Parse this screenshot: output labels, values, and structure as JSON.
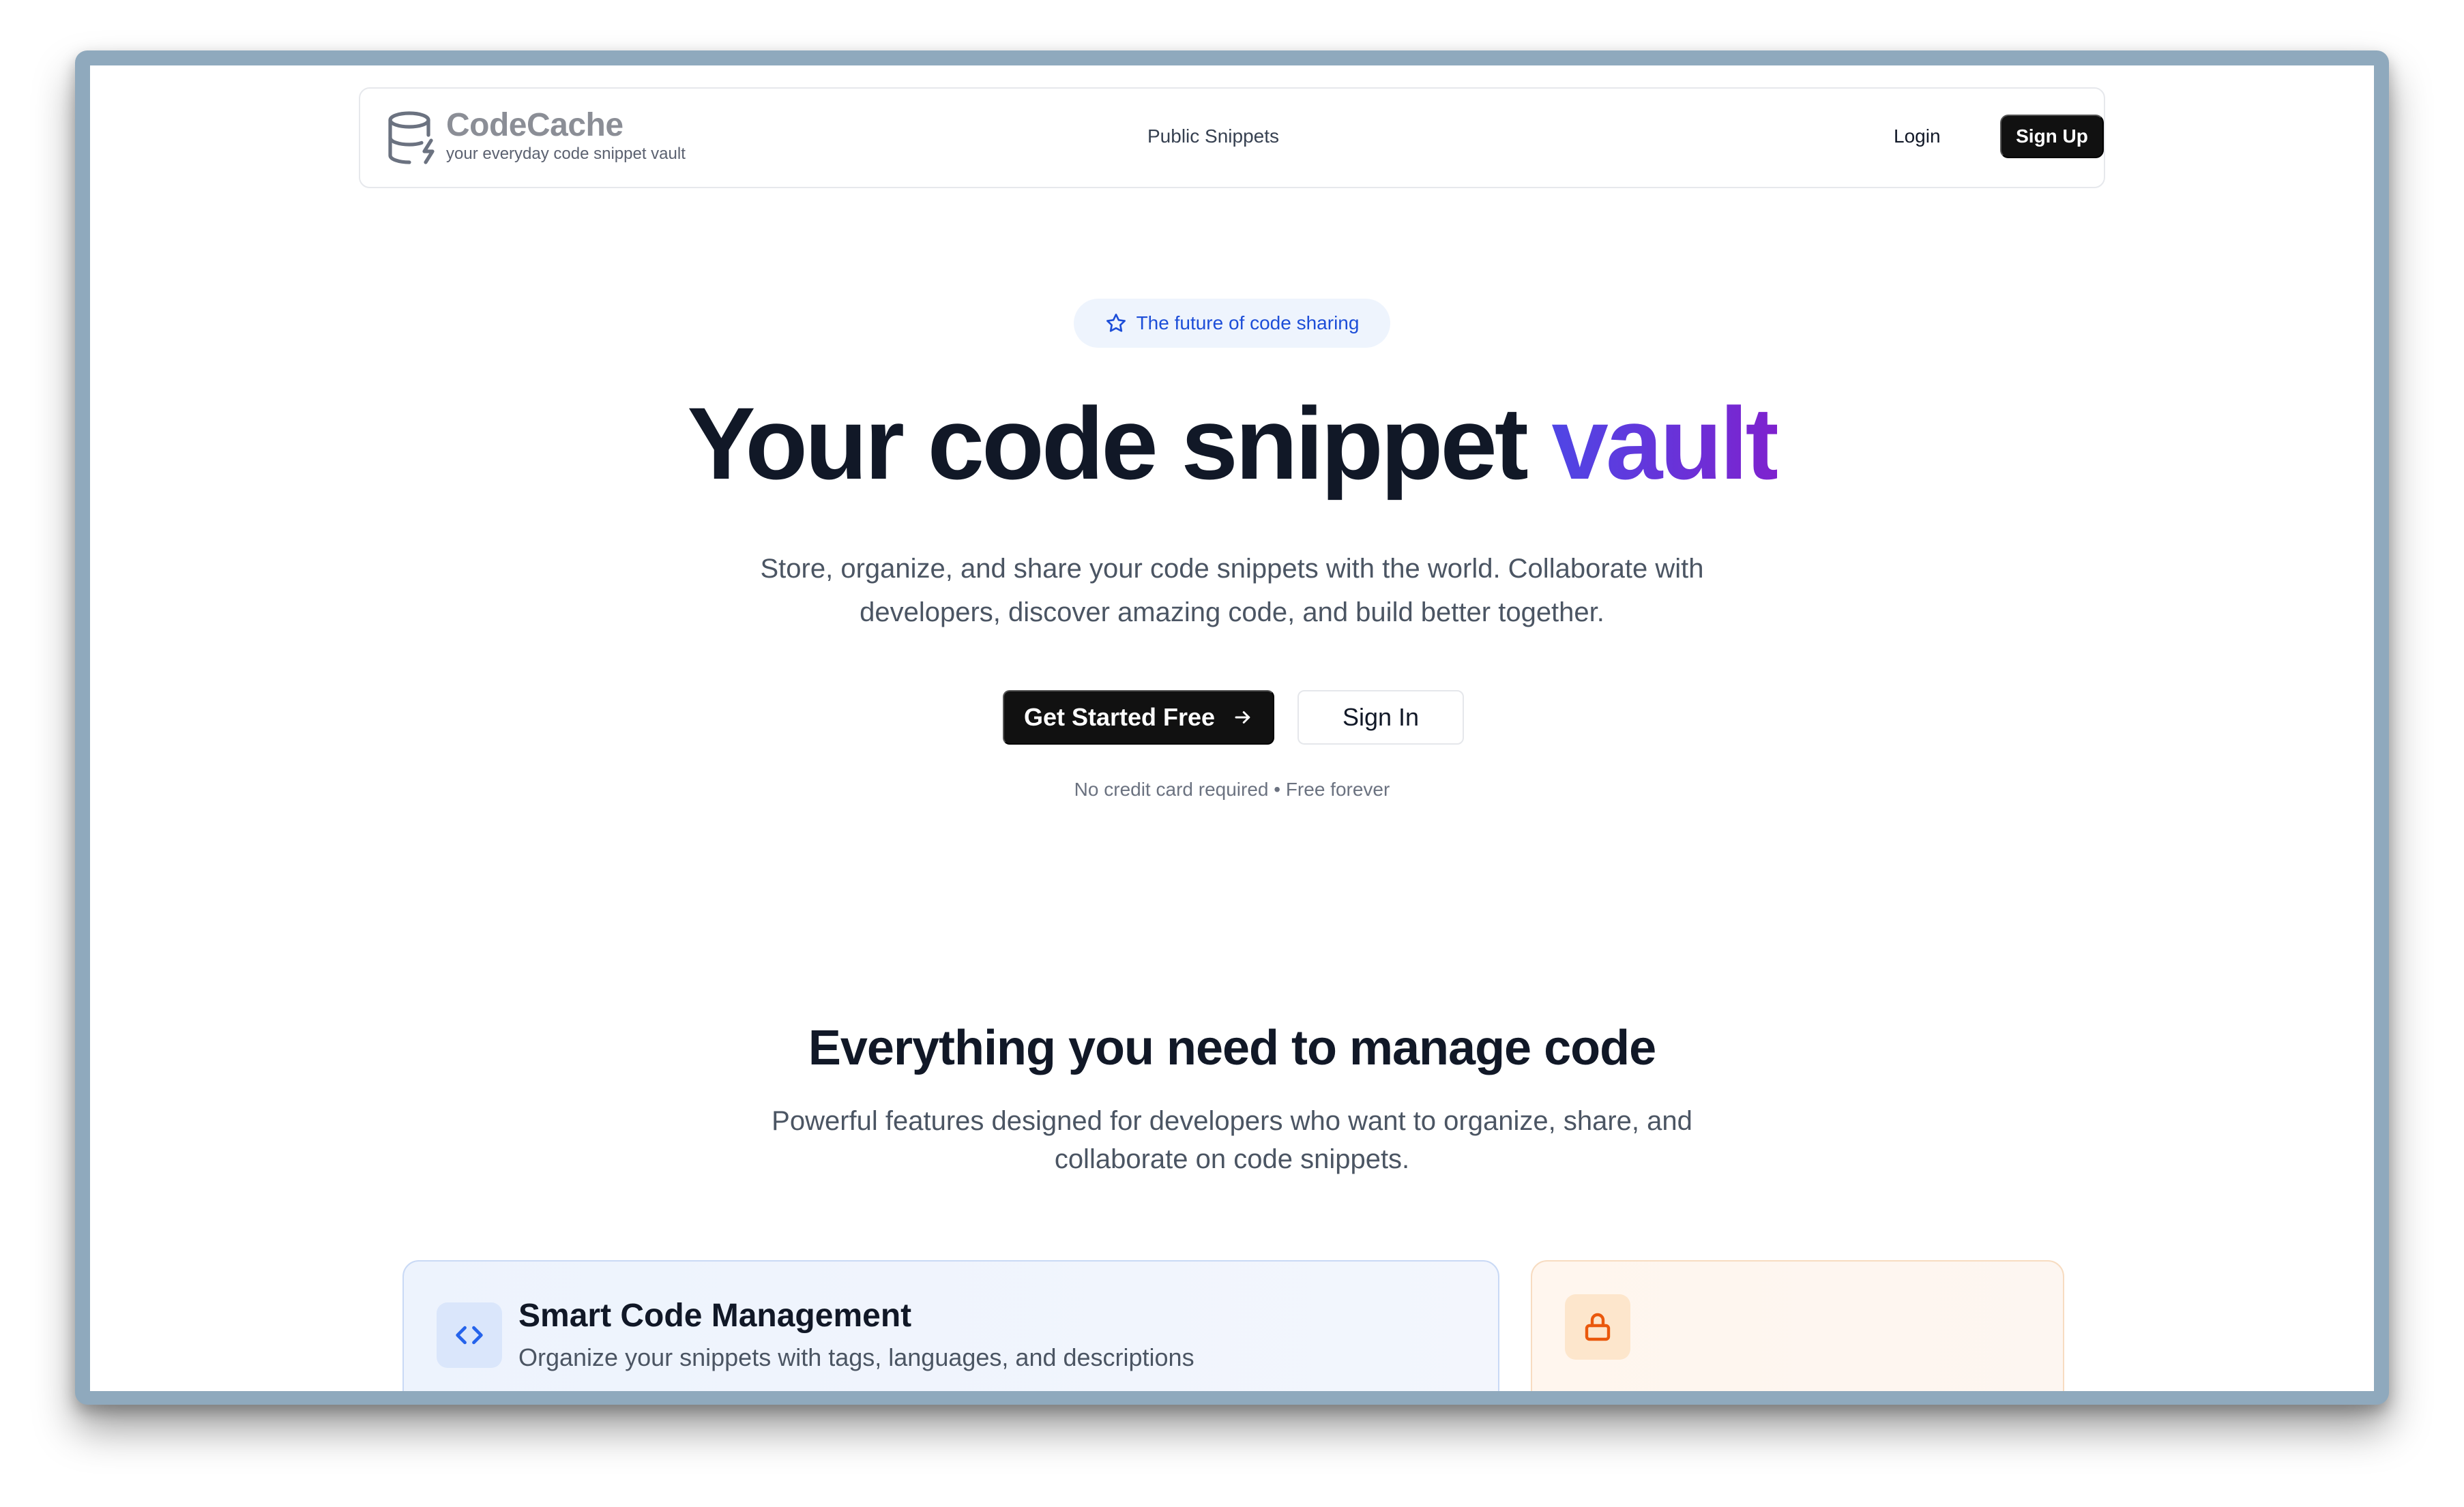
{
  "brand": {
    "name": "CodeCache",
    "tagline": "your everyday code snippet vault"
  },
  "nav": {
    "public_snippets": "Public Snippets",
    "login": "Login",
    "signup": "Sign Up"
  },
  "hero": {
    "badge": "The future of code sharing",
    "title_main": "Your code snippet ",
    "title_accent": "vault",
    "subtitle": "Store, organize, and share your code snippets with the world. Collaborate with developers, discover amazing code, and build better together.",
    "cta_primary": "Get Started Free",
    "cta_secondary": "Sign In",
    "note": "No credit card required • Free forever"
  },
  "features": {
    "title": "Everything you need to manage code",
    "subtitle": "Powerful features designed for developers who want to organize, share, and collaborate on code snippets.",
    "cards": [
      {
        "icon": "code-icon",
        "title": "Smart Code Management",
        "description": "Organize your snippets with tags, languages, and descriptions"
      },
      {
        "icon": "lock-icon",
        "title": "",
        "description": ""
      }
    ]
  },
  "colors": {
    "accent_gradient_start": "#4f46e5",
    "accent_gradient_end": "#7e22ce",
    "primary_button": "#111111",
    "badge_text": "#1d4ed8"
  }
}
